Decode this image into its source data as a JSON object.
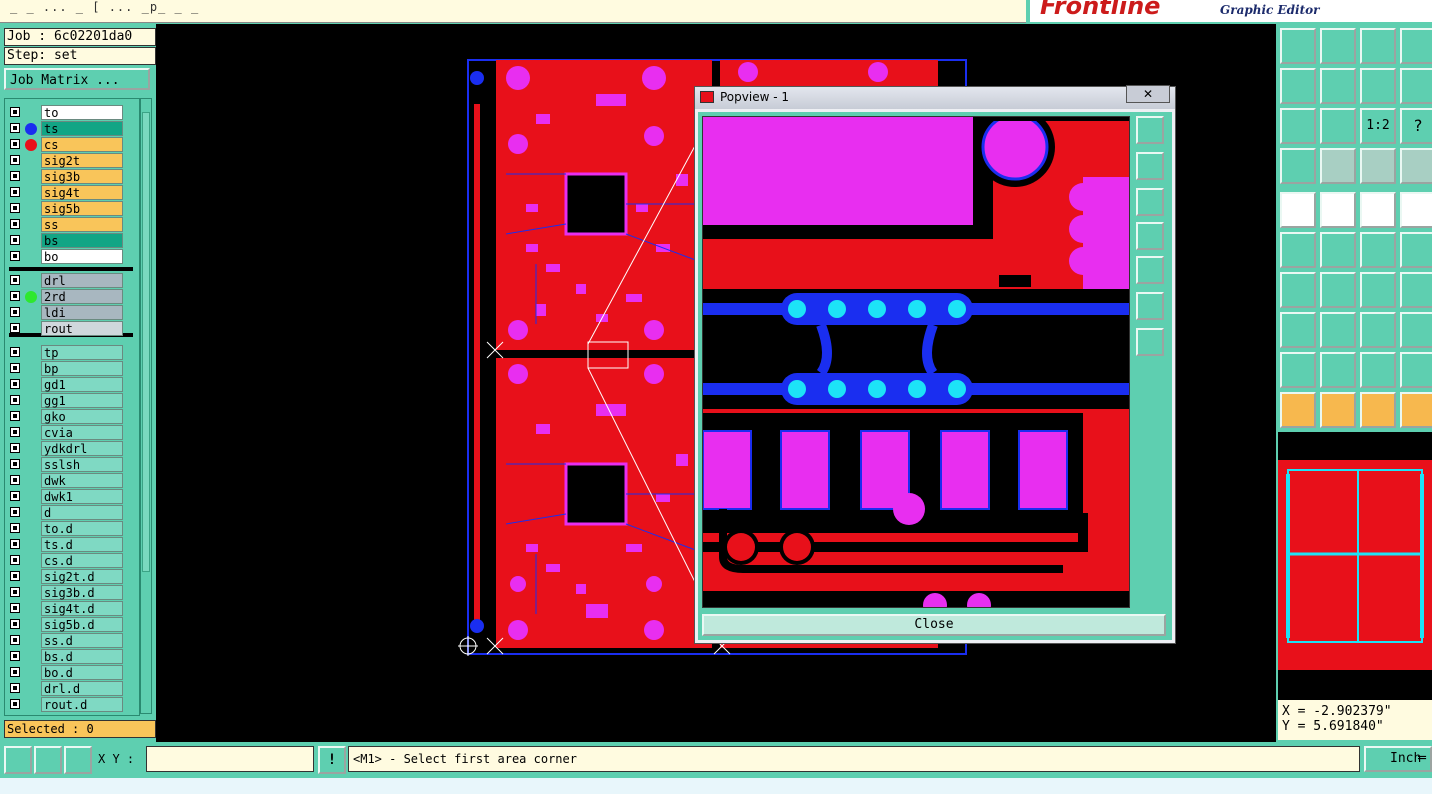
{
  "window": {
    "title_fragment": "_ _ ... _ [ ... _p_ _ _",
    "brand_logo": "Frontline",
    "brand_subtitle": "Graphic Editor"
  },
  "job": {
    "job_label": "Job : 6c02201da0",
    "step_label": "Step: set",
    "matrix_button": "Job Matrix ..."
  },
  "layers": [
    {
      "name": "to",
      "color": "#ffffff",
      "dot": ""
    },
    {
      "name": "ts",
      "color": "#12a585",
      "dot": "#1a2ef0"
    },
    {
      "name": "cs",
      "color": "#f9c55a",
      "dot": "#e8101a"
    },
    {
      "name": "sig2t",
      "color": "#f9c55a",
      "dot": ""
    },
    {
      "name": "sig3b",
      "color": "#f9c55a",
      "dot": ""
    },
    {
      "name": "sig4t",
      "color": "#f9c55a",
      "dot": ""
    },
    {
      "name": "sig5b",
      "color": "#f9c55a",
      "dot": ""
    },
    {
      "name": "ss",
      "color": "#f9c55a",
      "dot": ""
    },
    {
      "name": "bs",
      "color": "#12a585",
      "dot": ""
    },
    {
      "name": "bo",
      "color": "#ffffff",
      "dot": ""
    },
    {
      "name": "drl",
      "color": "#a8b7c0",
      "dot": ""
    },
    {
      "name": "2rd",
      "color": "#a8b7c0",
      "dot": "#2ee82e"
    },
    {
      "name": "ldi",
      "color": "#a8b7c0",
      "dot": ""
    },
    {
      "name": "rout",
      "color": "#cfd7dc",
      "dot": ""
    },
    {
      "name": "tp",
      "color": "#7fd9c3",
      "dot": ""
    },
    {
      "name": "bp",
      "color": "#7fd9c3",
      "dot": ""
    },
    {
      "name": "gd1",
      "color": "#7fd9c3",
      "dot": ""
    },
    {
      "name": "gg1",
      "color": "#7fd9c3",
      "dot": ""
    },
    {
      "name": "gko",
      "color": "#7fd9c3",
      "dot": ""
    },
    {
      "name": "cvia",
      "color": "#7fd9c3",
      "dot": ""
    },
    {
      "name": "ydkdrl",
      "color": "#7fd9c3",
      "dot": ""
    },
    {
      "name": "sslsh",
      "color": "#7fd9c3",
      "dot": ""
    },
    {
      "name": "dwk",
      "color": "#7fd9c3",
      "dot": ""
    },
    {
      "name": "dwk1",
      "color": "#7fd9c3",
      "dot": ""
    },
    {
      "name": "d",
      "color": "#7fd9c3",
      "dot": ""
    },
    {
      "name": "to.d",
      "color": "#7fd9c3",
      "dot": ""
    },
    {
      "name": "ts.d",
      "color": "#7fd9c3",
      "dot": ""
    },
    {
      "name": "cs.d",
      "color": "#7fd9c3",
      "dot": ""
    },
    {
      "name": "sig2t.d",
      "color": "#7fd9c3",
      "dot": ""
    },
    {
      "name": "sig3b.d",
      "color": "#7fd9c3",
      "dot": ""
    },
    {
      "name": "sig4t.d",
      "color": "#7fd9c3",
      "dot": ""
    },
    {
      "name": "sig5b.d",
      "color": "#7fd9c3",
      "dot": ""
    },
    {
      "name": "ss.d",
      "color": "#7fd9c3",
      "dot": ""
    },
    {
      "name": "bs.d",
      "color": "#7fd9c3",
      "dot": ""
    },
    {
      "name": "bo.d",
      "color": "#7fd9c3",
      "dot": ""
    },
    {
      "name": "drl.d",
      "color": "#7fd9c3",
      "dot": ""
    },
    {
      "name": "rout.d",
      "color": "#7fd9c3",
      "dot": ""
    }
  ],
  "selected": "Selected : 0",
  "popview": {
    "title": "Popview - 1",
    "close_x": "✕",
    "close_button": "Close"
  },
  "coords": {
    "x": "X = -2.902379\"",
    "y": "Y =  5.691840\""
  },
  "bottom": {
    "xy_label": "X Y :",
    "xy_value": "",
    "prompt": "<M1> - Select first area corner",
    "unit": "Inch",
    "warn_icon_label": "!"
  },
  "colors": {
    "panel": "#5ecfb0",
    "board": "#e8101a",
    "pad": "#e82ef0",
    "trace": "#1a2ef0",
    "via": "#1de3f7"
  }
}
